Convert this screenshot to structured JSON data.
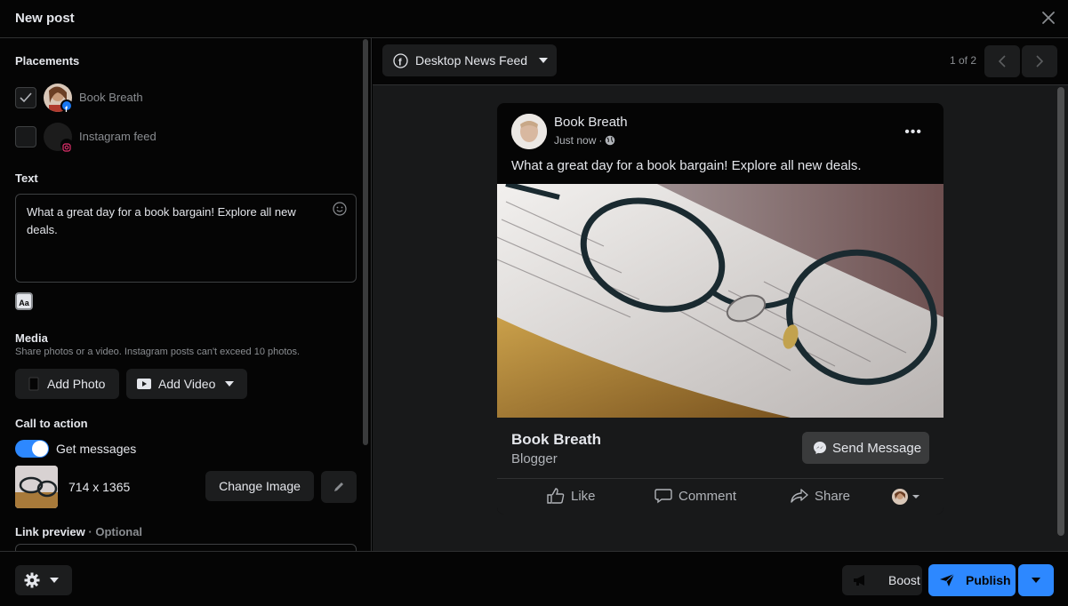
{
  "header": {
    "title": "New post"
  },
  "placements": {
    "title": "Placements",
    "items": [
      {
        "label": "Book Breath",
        "checked": true,
        "badge_icon": "facebook-icon"
      },
      {
        "label": "Instagram feed",
        "checked": false,
        "badge_icon": "instagram-icon"
      }
    ]
  },
  "text_section": {
    "title": "Text",
    "value": "What a great day for a book bargain! Explore all new deals.",
    "format_label": "Aa"
  },
  "media": {
    "title": "Media",
    "subtitle": "Share photos or a video. Instagram posts can't exceed 10 photos.",
    "add_photo": "Add Photo",
    "add_video": "Add Video"
  },
  "cta": {
    "title": "Call to action",
    "toggle_label": "Get messages",
    "toggle_on": true,
    "image_dims": "714 x 1365",
    "change_image": "Change Image"
  },
  "link_preview": {
    "title": "Link preview",
    "optional": "Optional"
  },
  "preview": {
    "feed_select": "Desktop News Feed",
    "page_count": "1 of 2",
    "post": {
      "author": "Book Breath",
      "time": "Just now",
      "text": "What a great day for a book bargain! Explore all new deals.",
      "cta_title": "Book Breath",
      "cta_subtitle": "Blogger",
      "send_button": "Send Message",
      "actions": {
        "like": "Like",
        "comment": "Comment",
        "share": "Share"
      }
    }
  },
  "footer": {
    "boost": "Boost",
    "publish": "Publish"
  },
  "colors": {
    "accent": "#2d88ff",
    "background": "#050505",
    "surface": "#1c1d1e",
    "preview_bg": "#18191a"
  }
}
